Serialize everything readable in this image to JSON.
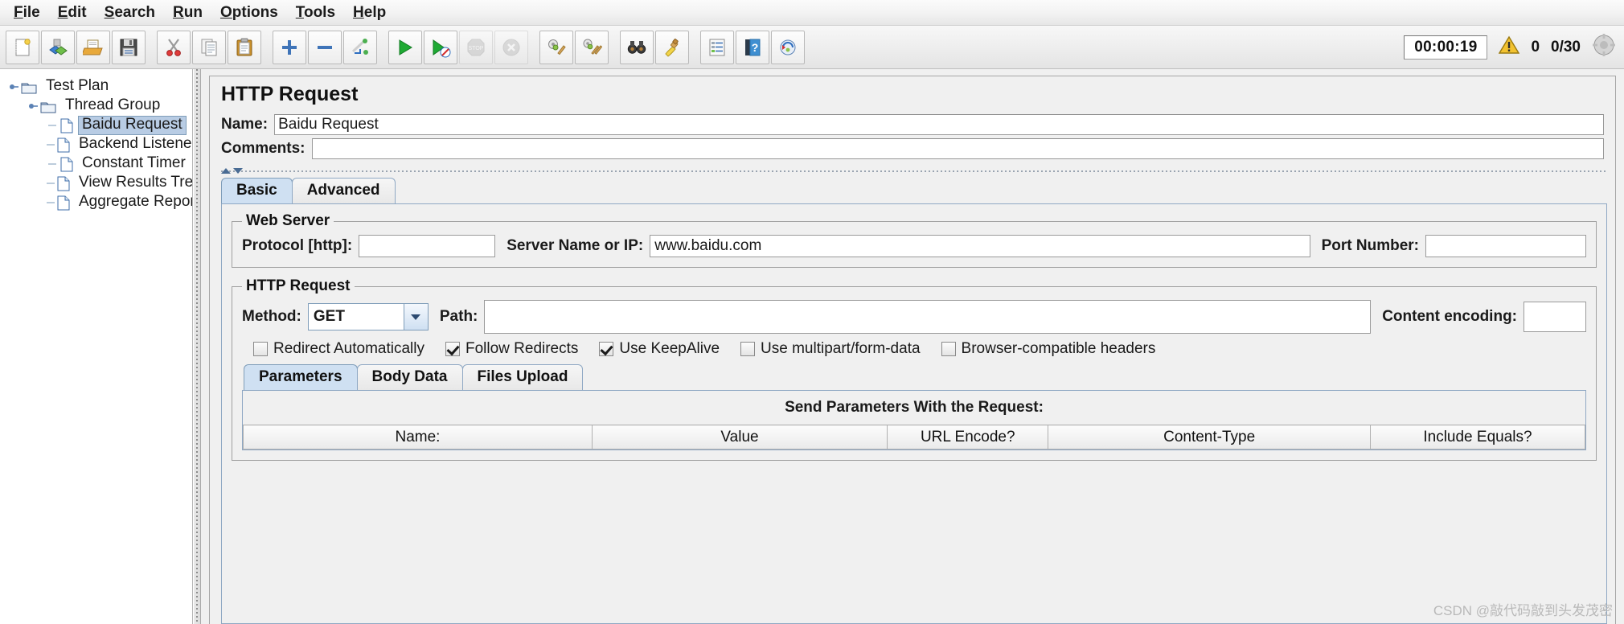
{
  "menubar": {
    "items": [
      {
        "label": "File",
        "mnemonic": "F"
      },
      {
        "label": "Edit",
        "mnemonic": "E"
      },
      {
        "label": "Search",
        "mnemonic": "S"
      },
      {
        "label": "Run",
        "mnemonic": "R"
      },
      {
        "label": "Options",
        "mnemonic": "O"
      },
      {
        "label": "Tools",
        "mnemonic": "T"
      },
      {
        "label": "Help",
        "mnemonic": "H"
      }
    ]
  },
  "toolbar": {
    "buttons": [
      {
        "name": "new-icon",
        "tooltip": "New"
      },
      {
        "name": "templates-icon",
        "tooltip": "Templates"
      },
      {
        "name": "open-icon",
        "tooltip": "Open"
      },
      {
        "name": "save-icon",
        "tooltip": "Save Test Plan"
      },
      {
        "name": "cut-icon",
        "tooltip": "Cut"
      },
      {
        "name": "copy-icon",
        "tooltip": "Copy"
      },
      {
        "name": "paste-icon",
        "tooltip": "Paste"
      },
      {
        "name": "expand-all-icon",
        "tooltip": "Expand All"
      },
      {
        "name": "collapse-all-icon",
        "tooltip": "Collapse All"
      },
      {
        "name": "toggle-icon",
        "tooltip": "Toggle"
      },
      {
        "name": "start-icon",
        "tooltip": "Start"
      },
      {
        "name": "start-no-pauses-icon",
        "tooltip": "Start no pauses"
      },
      {
        "name": "stop-icon",
        "tooltip": "Stop"
      },
      {
        "name": "shutdown-icon",
        "tooltip": "Shutdown"
      },
      {
        "name": "clear-icon",
        "tooltip": "Clear"
      },
      {
        "name": "clear-all-icon",
        "tooltip": "Clear All"
      },
      {
        "name": "search-icon",
        "tooltip": "Search"
      },
      {
        "name": "reset-search-icon",
        "tooltip": "Reset Search"
      },
      {
        "name": "function-helper-icon",
        "tooltip": "Function Helper Dialog"
      },
      {
        "name": "help-icon",
        "tooltip": "Help"
      },
      {
        "name": "undo-redo-icon",
        "tooltip": "Undo"
      }
    ],
    "status": {
      "timer": "00:00:19",
      "warning_icon": "warning-triangle-icon",
      "warning_count": "0",
      "thread_count": "0/30",
      "indicator_icon": "thread-indicator-icon"
    }
  },
  "tree": {
    "items": [
      {
        "label": "Test Plan",
        "icon": "folder-icon",
        "depth": 0,
        "selected": false,
        "expander": true
      },
      {
        "label": "Thread Group",
        "icon": "folder-icon",
        "depth": 1,
        "selected": false,
        "expander": true
      },
      {
        "label": "Baidu Request",
        "icon": "document-icon",
        "depth": 2,
        "selected": true,
        "expander": false
      },
      {
        "label": "Backend Listener",
        "icon": "document-icon",
        "depth": 2,
        "selected": false,
        "expander": false
      },
      {
        "label": "Constant Timer",
        "icon": "document-icon",
        "depth": 2,
        "selected": false,
        "expander": false
      },
      {
        "label": "View Results Tree",
        "icon": "document-icon",
        "depth": 2,
        "selected": false,
        "expander": false
      },
      {
        "label": "Aggregate Report",
        "icon": "document-icon",
        "depth": 2,
        "selected": false,
        "expander": false
      }
    ]
  },
  "panel": {
    "title": "HTTP Request",
    "name_label": "Name:",
    "name_value": "Baidu Request",
    "comments_label": "Comments:",
    "comments_value": "",
    "tabs": [
      {
        "label": "Basic",
        "active": true
      },
      {
        "label": "Advanced",
        "active": false
      }
    ],
    "web_server": {
      "legend": "Web Server",
      "protocol_label": "Protocol [http]:",
      "protocol_value": "",
      "server_label": "Server Name or IP:",
      "server_value": "www.baidu.com",
      "port_label": "Port Number:",
      "port_value": ""
    },
    "http_request": {
      "legend": "HTTP Request",
      "method_label": "Method:",
      "method_value": "GET",
      "path_label": "Path:",
      "path_value": "",
      "content_encoding_label": "Content encoding:",
      "content_encoding_value": ""
    },
    "checkboxes": [
      {
        "label": "Redirect Automatically",
        "checked": false
      },
      {
        "label": "Follow Redirects",
        "checked": true
      },
      {
        "label": "Use KeepAlive",
        "checked": true
      },
      {
        "label": "Use multipart/form-data",
        "checked": false
      },
      {
        "label": "Browser-compatible headers",
        "checked": false
      }
    ],
    "inner_tabs": [
      {
        "label": "Parameters",
        "active": true
      },
      {
        "label": "Body Data",
        "active": false
      },
      {
        "label": "Files Upload",
        "active": false
      }
    ],
    "params_table": {
      "caption": "Send Parameters With the Request:",
      "columns": [
        "Name:",
        "Value",
        "URL Encode?",
        "Content-Type",
        "Include Equals?"
      ],
      "rows": []
    }
  },
  "watermark": "CSDN @敲代码敲到头发茂密"
}
